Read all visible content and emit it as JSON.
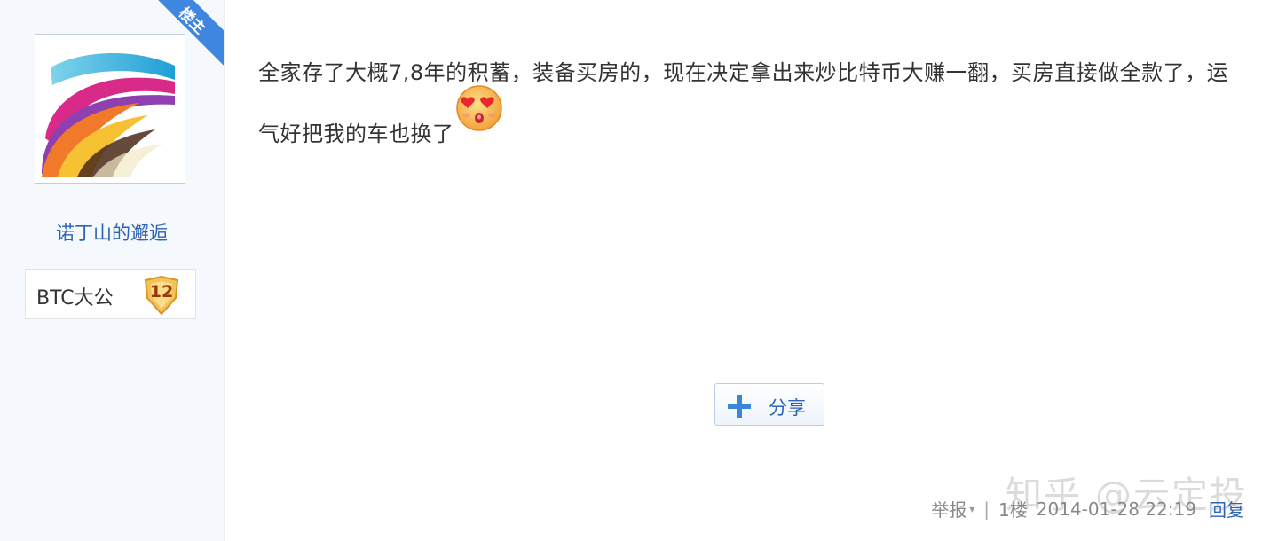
{
  "author": {
    "badge_label": "楼主",
    "username": "诺丁山的邂逅",
    "level_name": "BTC大公",
    "level": "12"
  },
  "post": {
    "text": "全家存了大概7,8年的积蓄，装备买房的，现在决定拿出来炒比特币大赚一翻，买房直接做全款了，运气好把我的车也换了",
    "emoji": "heart-eyes-kiss-emoji"
  },
  "share_button": {
    "label": "分享",
    "icon": "plus-icon"
  },
  "footer": {
    "report_label": "举报",
    "caret": "▾",
    "separator": "|",
    "floor": "1楼",
    "timestamp": "2014-01-28 22:19",
    "reply_label": "回复"
  },
  "watermark": "知乎 @云定投",
  "colors": {
    "link": "#2d64b3",
    "ribbon": "#3f86e0",
    "sidebar_bg": "#f5f8fc"
  }
}
